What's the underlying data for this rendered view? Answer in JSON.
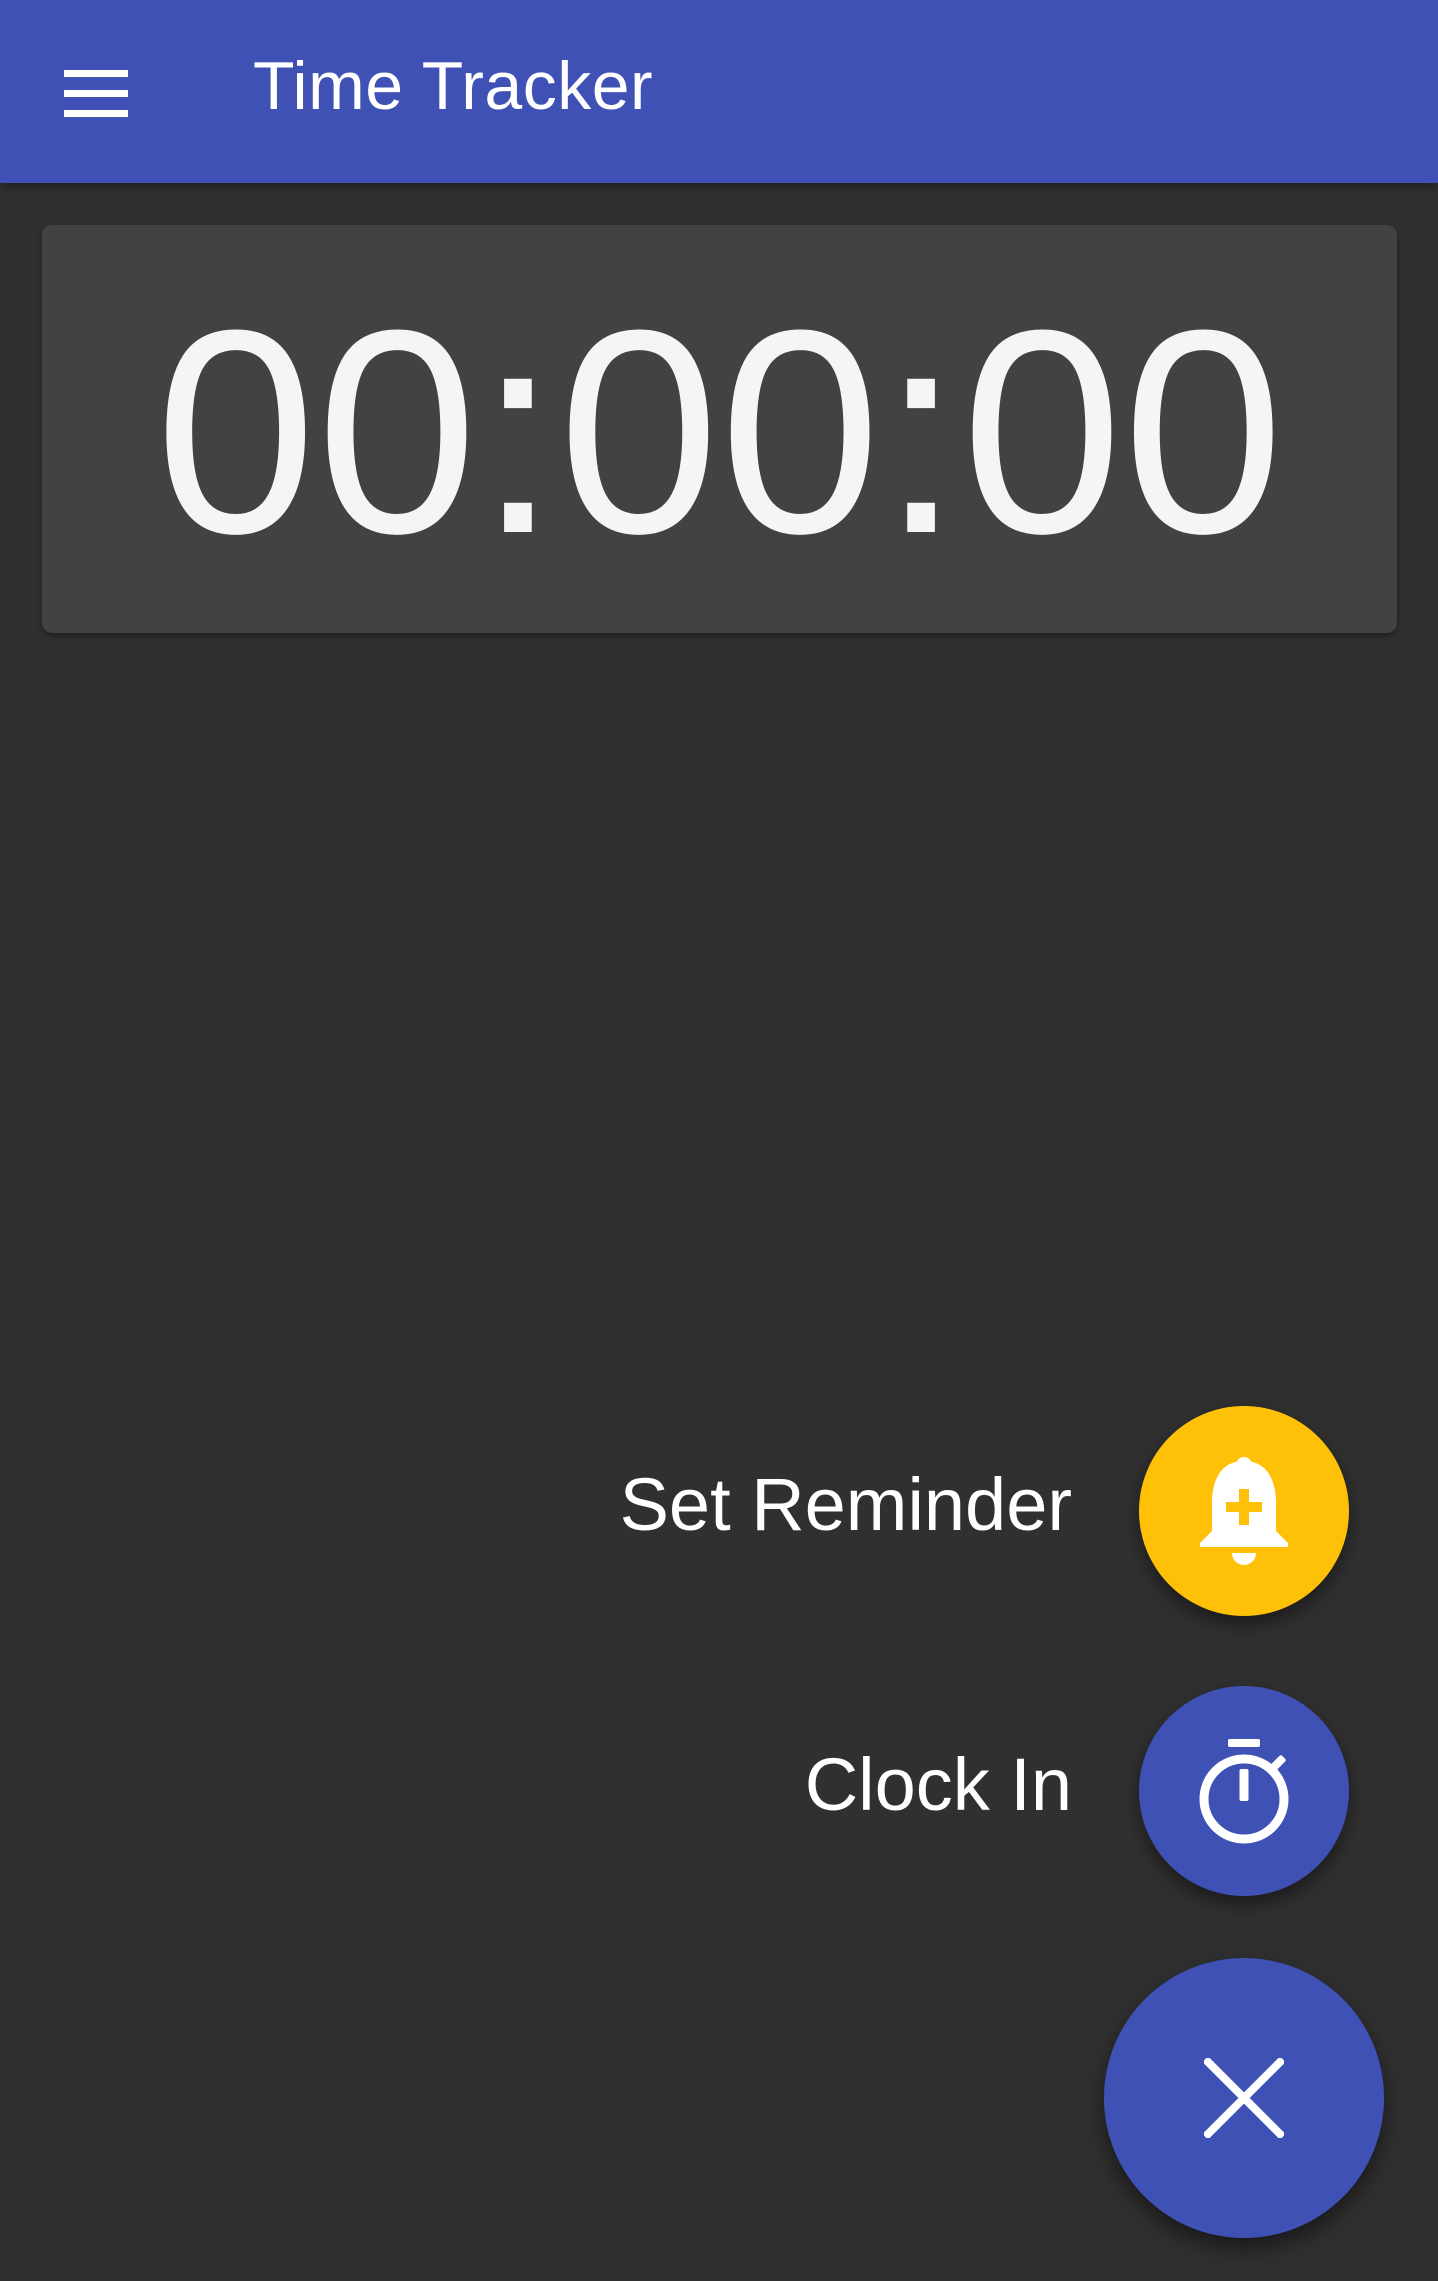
{
  "app_bar": {
    "title": "Time Tracker",
    "menu_icon": "hamburger-menu-icon",
    "background_color": "#3F51B5"
  },
  "timer": {
    "display": "00:00:00"
  },
  "speed_dial": {
    "actions": [
      {
        "label": "Set Reminder",
        "icon": "bell-plus-icon",
        "color": "#FFC107"
      },
      {
        "label": "Clock In",
        "icon": "stopwatch-icon",
        "color": "#3F51B5"
      }
    ],
    "main_button": {
      "icon": "close-icon",
      "color": "#3F51B5"
    }
  }
}
